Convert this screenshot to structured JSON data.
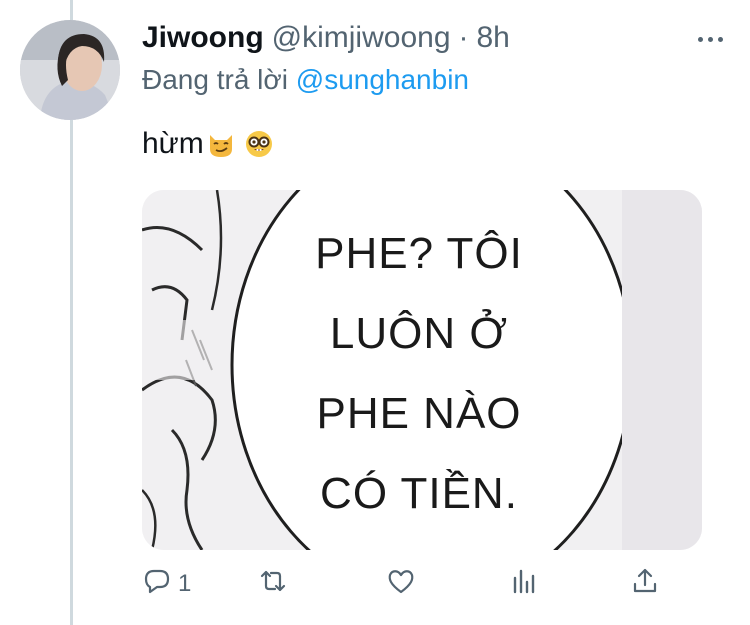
{
  "tweet": {
    "display_name": "Jiwoong",
    "handle": "@kimjiwoong",
    "separator": "·",
    "time": "8h",
    "reply_prefix": "Đang trả lời",
    "reply_to": "@sunghanbin",
    "text": "hừm",
    "emojis": [
      "smirking-cat-emoji",
      "nerd-face-emoji"
    ]
  },
  "media": {
    "speech_bubble_lines": [
      "PHE? TÔI",
      "LUÔN Ở",
      "PHE NÀO",
      "CÓ TIỀN."
    ]
  },
  "actions": {
    "reply_icon": "reply-icon",
    "reply_count": "1",
    "retweet_icon": "retweet-icon",
    "like_icon": "heart-icon",
    "analytics_icon": "analytics-icon",
    "share_icon": "share-icon"
  },
  "colors": {
    "text": "#0f1419",
    "secondary": "#536471",
    "accent": "#1d9bf0",
    "thread_line": "#cfd9de"
  }
}
